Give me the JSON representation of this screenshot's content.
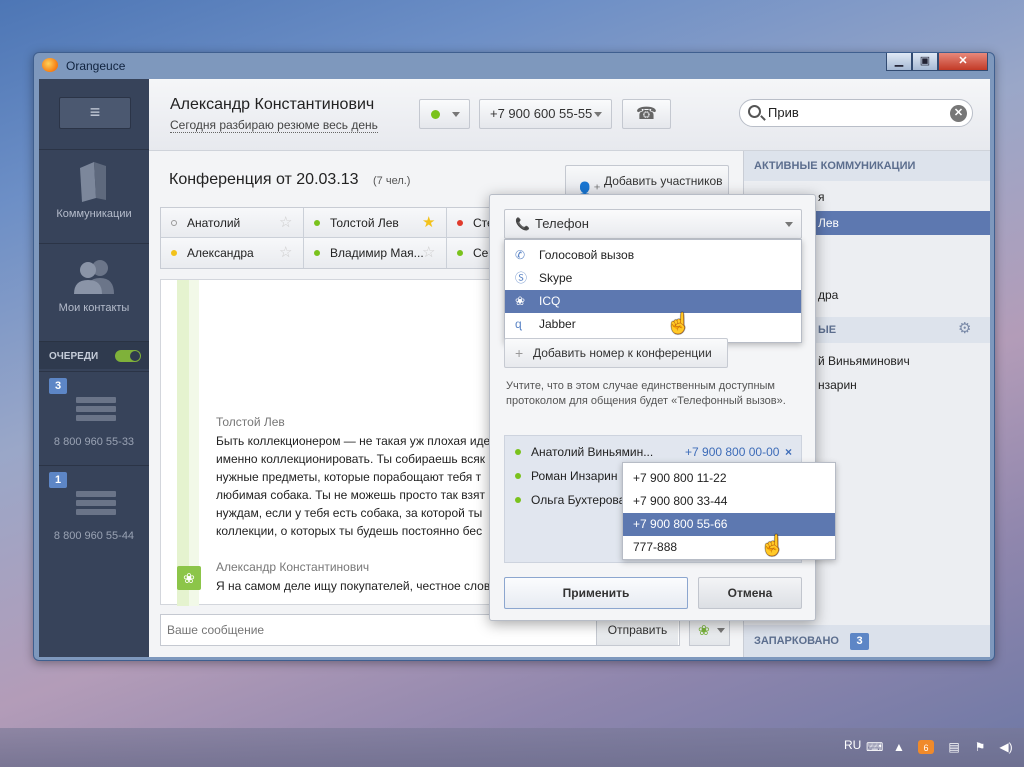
{
  "window": {
    "title": "Orangeuce"
  },
  "sidebar": {
    "communications_label": "Коммуникации",
    "contacts_label": "Мои контакты",
    "queues_label": "ОЧЕРЕДИ",
    "queues": [
      {
        "badge": "3",
        "number": "8 800 960 55-33"
      },
      {
        "badge": "1",
        "number": "8 800 960 55-44"
      }
    ]
  },
  "header": {
    "user_name": "Александр Константинович",
    "user_status": "Сегодня разбираю резюме весь день",
    "phone": "+7 900 600 55-55",
    "search_value": "Прив"
  },
  "conference": {
    "title": "Конференция от 20.03.13",
    "count": "(7 чел.)",
    "add_participants": "Добавить участников",
    "participants": [
      {
        "name": "Анатолий",
        "dot": "#ffffff",
        "star": false
      },
      {
        "name": "Толстой Лев",
        "dot": "#7ac21c",
        "star": true
      },
      {
        "name": "Сте",
        "dot": "#e03a2c",
        "star": false
      },
      {
        "name": "Александра",
        "dot": "#f2c21b",
        "star": false
      },
      {
        "name": "Владимир Мая...",
        "dot": "#7ac21c",
        "star": false
      },
      {
        "name": "Сер",
        "dot": "#7ac21c",
        "star": false
      }
    ]
  },
  "chat": {
    "messages": [
      {
        "from": "Толстой Лев",
        "lines": [
          "Быть коллекционером — не такая уж плохая иде",
          "именно коллекционировать. Ты собираешь всяк",
          "нужные предметы, которые порабощают тебя т",
          "любимая собака. Ты не можешь просто так взят",
          "нуждам, если у тебя есть собака, за которой ты",
          "коллекции, о которых ты будешь постоянно бес"
        ]
      },
      {
        "from": "Александр Константинович",
        "lines": [
          "Я на самом деле ищу покупателей, честное слов"
        ]
      }
    ],
    "input_placeholder": "Ваше сообщение",
    "send_label": "Отправить"
  },
  "right_panel": {
    "active_header": "АКТИВНЫЕ КОММУНИКАЦИИ",
    "rows": [
      "я",
      "Лев",
      "",
      "дра",
      "ЫЕ",
      "й Виньяминович",
      "нзарин"
    ],
    "parked_label": "ЗАПАРКОВАНО",
    "parked_count": "3"
  },
  "dialog": {
    "protocol_selected": "Телефон",
    "protocol_options": [
      {
        "label": "Голосовой вызов",
        "icon": "phone-icon"
      },
      {
        "label": "Skype",
        "icon": "skype-icon"
      },
      {
        "label": "ICQ",
        "icon": "icq-icon"
      },
      {
        "label": "Jabber",
        "icon": "jabber-icon"
      }
    ],
    "add_number": "Добавить номер к конференции",
    "note": "Учтите, что в этом случае единственным доступным протоколом для общения будет «Телефонный вызов».",
    "numbers": [
      {
        "name": "Анатолий Виньямин...",
        "number": "+7 900 800 00-00"
      },
      {
        "name": "Роман Инзарин",
        "number": ""
      },
      {
        "name": "Ольга Бухтерова",
        "number": ""
      }
    ],
    "number_options": [
      "+7 900 800 11-22",
      "+7 900 800 33-44",
      "+7 900 800 55-66",
      "777-888"
    ],
    "apply": "Применить",
    "cancel": "Отмена"
  },
  "taskbar": {
    "lang": "RU",
    "badge": "6"
  },
  "colors": {
    "accent": "#5d78b0",
    "sidebar": "#37435a",
    "online": "#7ac21c"
  }
}
